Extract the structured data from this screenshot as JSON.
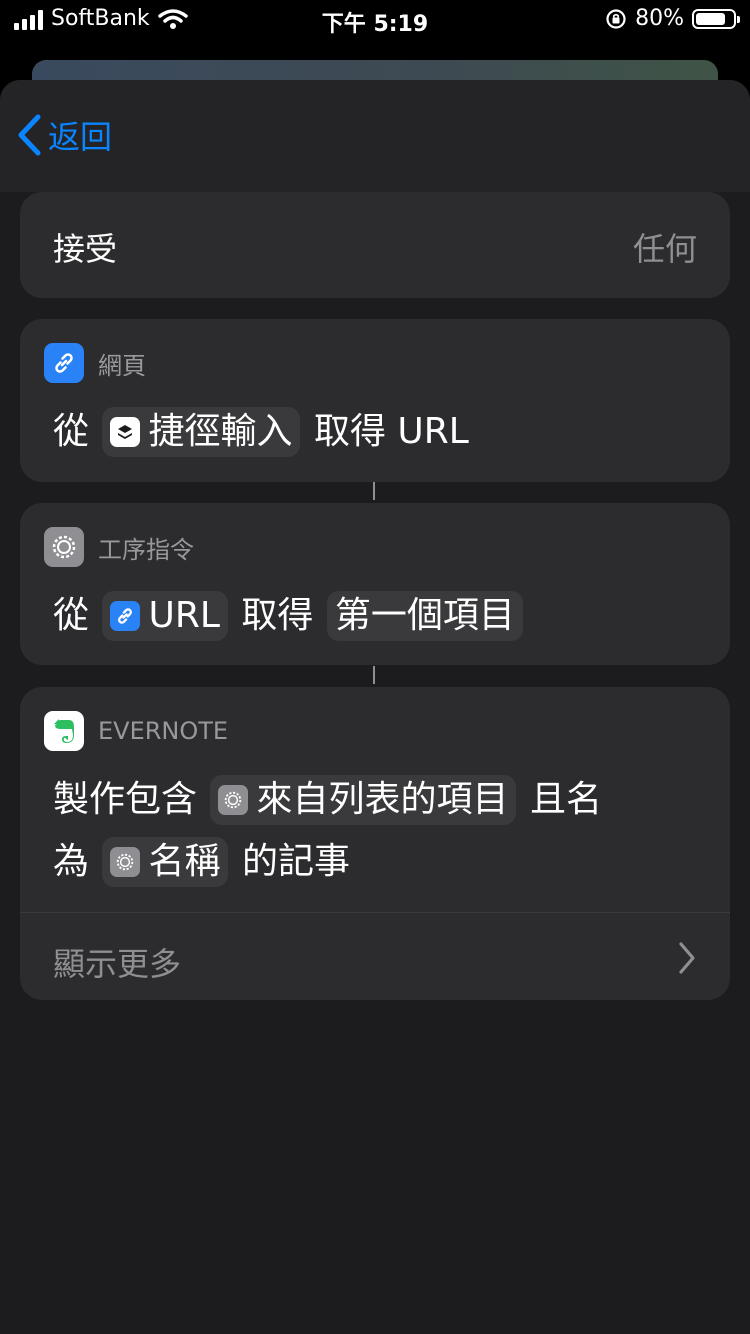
{
  "status_bar": {
    "carrier": "SoftBank",
    "time": "下午 5:19",
    "battery": "80%",
    "battery_level": 0.8
  },
  "nav": {
    "back_label": "返回"
  },
  "accept": {
    "label": "接受",
    "value": "任何"
  },
  "actions": [
    {
      "app": "網頁",
      "icon": "link-icon",
      "parts": {
        "from": "從",
        "input_token": "捷徑輸入",
        "get": "取得 URL"
      }
    },
    {
      "app": "工序指令",
      "icon": "gear-icon",
      "parts": {
        "from": "從",
        "url_token": "URL",
        "get": "取得",
        "item_token": "第一個項目"
      }
    },
    {
      "app": "EVERNOTE",
      "icon": "evernote-elephant-icon",
      "parts": {
        "make": "製作包含",
        "list_token": "來自列表的項目",
        "named": "且名",
        "as": "為",
        "name_token": "名稱",
        "note": "的記事"
      },
      "show_more": "顯示更多"
    }
  ],
  "colors": {
    "accent": "#0a84ff",
    "card": "#2c2c2e",
    "sheet": "#1c1c1e",
    "evernote": "#2dbe60"
  }
}
